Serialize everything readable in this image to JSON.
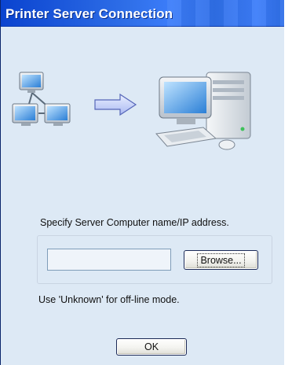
{
  "window": {
    "title": "Printer Server Connection"
  },
  "illustration": {
    "left_icon": "network-computers-icon",
    "arrow_icon": "right-arrow-icon",
    "right_icon": "server-computer-icon"
  },
  "form": {
    "prompt": "Specify Server Computer name/IP address.",
    "server_value": "",
    "server_placeholder": "",
    "browse_label": "Browse...",
    "note": "Use 'Unknown' for off-line mode.",
    "ok_label": "OK"
  },
  "colors": {
    "titlebar": "#0a43cf",
    "dialog_background": "#dde9f5"
  }
}
